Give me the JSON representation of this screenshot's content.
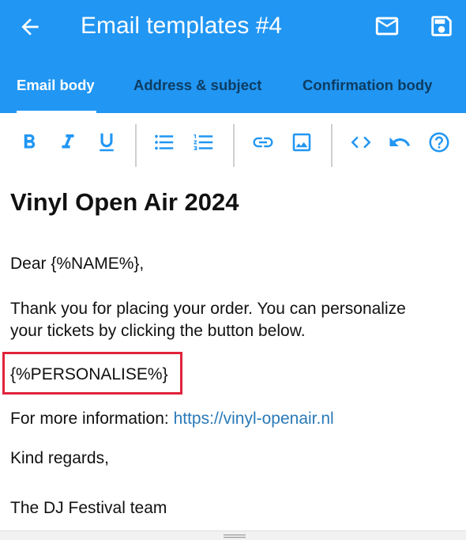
{
  "appbar": {
    "title": "Email templates #4",
    "background": "#2196f3",
    "back_icon": "arrow-left-icon",
    "actions": [
      {
        "name": "mail-icon"
      },
      {
        "name": "save-icon"
      }
    ]
  },
  "tabs": [
    {
      "label": "Email body",
      "active": true
    },
    {
      "label": "Address & subject",
      "active": false
    },
    {
      "label": "Confirmation body",
      "active": false
    }
  ],
  "toolbar": {
    "accent": "#2196f3",
    "buttons": [
      "bold-icon",
      "italic-icon",
      "underline-icon",
      "bulleted-list-icon",
      "numbered-list-icon",
      "link-icon",
      "image-icon",
      "code-icon",
      "undo-icon",
      "help-icon"
    ]
  },
  "editor": {
    "heading": "Vinyl Open Air 2024",
    "greeting": "Dear {%NAME%},",
    "body_line1": "Thank you for placing your order. You can personalize",
    "body_line2": "your tickets by clicking the button below.",
    "placeholder": "{%PERSONALISE%}",
    "info_prefix": "For more information: ",
    "info_link": "https://vinyl-openair.nl",
    "closing": "Kind regards,",
    "signature": "The DJ Festival team"
  },
  "highlight_color": "#e0233a"
}
